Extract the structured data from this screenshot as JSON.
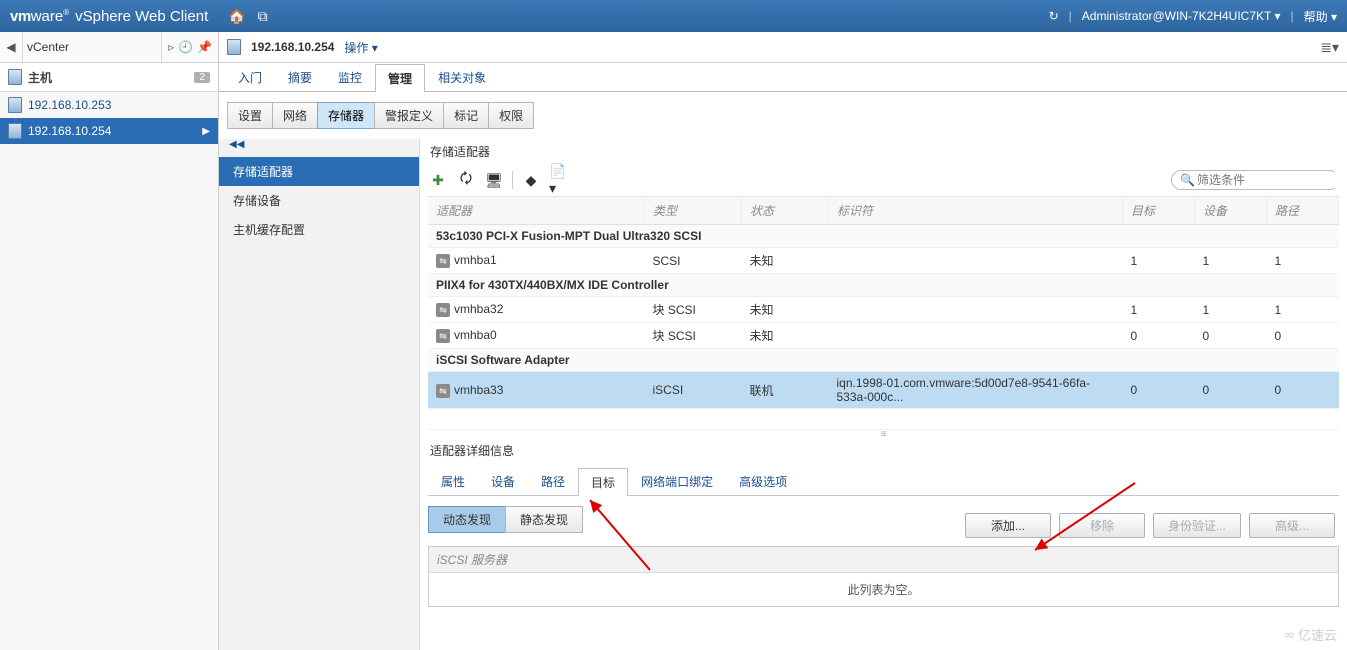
{
  "brand": {
    "a": "vm",
    "b": "ware",
    "c": "vSphere Web Client"
  },
  "user": "Administrator@WIN-7K2H4UIC7KT",
  "help": "帮助",
  "nav": {
    "back_label": "vCenter",
    "host_header": "主机",
    "host_badge": "2",
    "hosts": [
      {
        "label": "192.168.10.253"
      },
      {
        "label": "192.168.10.254"
      }
    ]
  },
  "context": {
    "title": "192.168.10.254",
    "actions_label": "操作"
  },
  "tabs_main": [
    "入门",
    "摘要",
    "监控",
    "管理",
    "相关对象"
  ],
  "tabs_main_active": 3,
  "tabs_sub": [
    "设置",
    "网络",
    "存储器",
    "警报定义",
    "标记",
    "权限"
  ],
  "tabs_sub_active": 2,
  "sidenav": {
    "items": [
      "存储适配器",
      "存储设备",
      "主机缓存配置"
    ],
    "active": 0
  },
  "panel_title": "存储适配器",
  "filter_placeholder": "筛选条件",
  "columns": [
    "适配器",
    "类型",
    "状态",
    "标识符",
    "目标",
    "设备",
    "路径"
  ],
  "groups": [
    {
      "title": "53c1030 PCI-X Fusion-MPT Dual Ultra320 SCSI",
      "rows": [
        {
          "name": "vmhba1",
          "type": "SCSI",
          "status": "未知",
          "id": "",
          "targets": "1",
          "devices": "1",
          "paths": "1"
        }
      ]
    },
    {
      "title": "PIIX4 for 430TX/440BX/MX IDE Controller",
      "rows": [
        {
          "name": "vmhba32",
          "type": "块 SCSI",
          "status": "未知",
          "id": "",
          "targets": "1",
          "devices": "1",
          "paths": "1"
        },
        {
          "name": "vmhba0",
          "type": "块 SCSI",
          "status": "未知",
          "id": "",
          "targets": "0",
          "devices": "0",
          "paths": "0"
        }
      ]
    },
    {
      "title": "iSCSI Software Adapter",
      "rows": [
        {
          "name": "vmhba33",
          "type": "iSCSI",
          "status": "联机",
          "id": "iqn.1998-01.com.vmware:5d00d7e8-9541-66fa-533a-000c...",
          "targets": "0",
          "devices": "0",
          "paths": "0",
          "selected": true
        }
      ]
    }
  ],
  "detail_title": "适配器详细信息",
  "detail_tabs": [
    "属性",
    "设备",
    "路径",
    "目标",
    "网络端口绑定",
    "高级选项"
  ],
  "detail_tabs_active": 3,
  "discovery_segments": [
    "动态发现",
    "静态发现"
  ],
  "discovery_active": 0,
  "action_buttons": [
    "添加...",
    "移除",
    "身份验证...",
    "高级..."
  ],
  "iscsi_col": "iSCSI 服务器",
  "iscsi_empty": "此列表为空。",
  "watermark": "亿速云"
}
